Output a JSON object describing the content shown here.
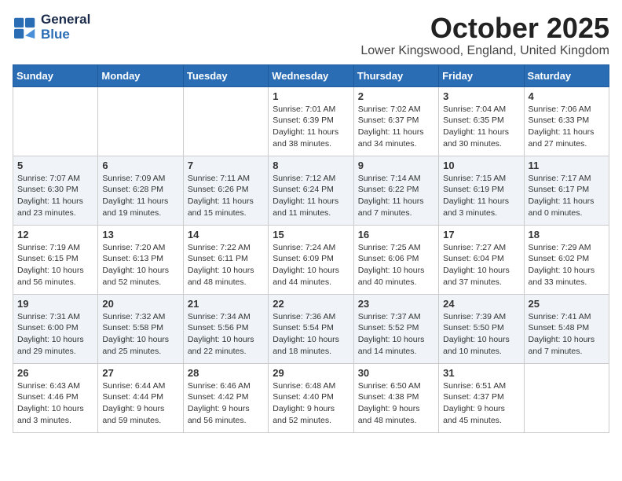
{
  "logo": {
    "line1": "General",
    "line2": "Blue"
  },
  "title": "October 2025",
  "location": "Lower Kingswood, England, United Kingdom",
  "days_of_week": [
    "Sunday",
    "Monday",
    "Tuesday",
    "Wednesday",
    "Thursday",
    "Friday",
    "Saturday"
  ],
  "weeks": [
    [
      {
        "day": "",
        "info": ""
      },
      {
        "day": "",
        "info": ""
      },
      {
        "day": "",
        "info": ""
      },
      {
        "day": "1",
        "info": "Sunrise: 7:01 AM\nSunset: 6:39 PM\nDaylight: 11 hours\nand 38 minutes."
      },
      {
        "day": "2",
        "info": "Sunrise: 7:02 AM\nSunset: 6:37 PM\nDaylight: 11 hours\nand 34 minutes."
      },
      {
        "day": "3",
        "info": "Sunrise: 7:04 AM\nSunset: 6:35 PM\nDaylight: 11 hours\nand 30 minutes."
      },
      {
        "day": "4",
        "info": "Sunrise: 7:06 AM\nSunset: 6:33 PM\nDaylight: 11 hours\nand 27 minutes."
      }
    ],
    [
      {
        "day": "5",
        "info": "Sunrise: 7:07 AM\nSunset: 6:30 PM\nDaylight: 11 hours\nand 23 minutes."
      },
      {
        "day": "6",
        "info": "Sunrise: 7:09 AM\nSunset: 6:28 PM\nDaylight: 11 hours\nand 19 minutes."
      },
      {
        "day": "7",
        "info": "Sunrise: 7:11 AM\nSunset: 6:26 PM\nDaylight: 11 hours\nand 15 minutes."
      },
      {
        "day": "8",
        "info": "Sunrise: 7:12 AM\nSunset: 6:24 PM\nDaylight: 11 hours\nand 11 minutes."
      },
      {
        "day": "9",
        "info": "Sunrise: 7:14 AM\nSunset: 6:22 PM\nDaylight: 11 hours\nand 7 minutes."
      },
      {
        "day": "10",
        "info": "Sunrise: 7:15 AM\nSunset: 6:19 PM\nDaylight: 11 hours\nand 3 minutes."
      },
      {
        "day": "11",
        "info": "Sunrise: 7:17 AM\nSunset: 6:17 PM\nDaylight: 11 hours\nand 0 minutes."
      }
    ],
    [
      {
        "day": "12",
        "info": "Sunrise: 7:19 AM\nSunset: 6:15 PM\nDaylight: 10 hours\nand 56 minutes."
      },
      {
        "day": "13",
        "info": "Sunrise: 7:20 AM\nSunset: 6:13 PM\nDaylight: 10 hours\nand 52 minutes."
      },
      {
        "day": "14",
        "info": "Sunrise: 7:22 AM\nSunset: 6:11 PM\nDaylight: 10 hours\nand 48 minutes."
      },
      {
        "day": "15",
        "info": "Sunrise: 7:24 AM\nSunset: 6:09 PM\nDaylight: 10 hours\nand 44 minutes."
      },
      {
        "day": "16",
        "info": "Sunrise: 7:25 AM\nSunset: 6:06 PM\nDaylight: 10 hours\nand 40 minutes."
      },
      {
        "day": "17",
        "info": "Sunrise: 7:27 AM\nSunset: 6:04 PM\nDaylight: 10 hours\nand 37 minutes."
      },
      {
        "day": "18",
        "info": "Sunrise: 7:29 AM\nSunset: 6:02 PM\nDaylight: 10 hours\nand 33 minutes."
      }
    ],
    [
      {
        "day": "19",
        "info": "Sunrise: 7:31 AM\nSunset: 6:00 PM\nDaylight: 10 hours\nand 29 minutes."
      },
      {
        "day": "20",
        "info": "Sunrise: 7:32 AM\nSunset: 5:58 PM\nDaylight: 10 hours\nand 25 minutes."
      },
      {
        "day": "21",
        "info": "Sunrise: 7:34 AM\nSunset: 5:56 PM\nDaylight: 10 hours\nand 22 minutes."
      },
      {
        "day": "22",
        "info": "Sunrise: 7:36 AM\nSunset: 5:54 PM\nDaylight: 10 hours\nand 18 minutes."
      },
      {
        "day": "23",
        "info": "Sunrise: 7:37 AM\nSunset: 5:52 PM\nDaylight: 10 hours\nand 14 minutes."
      },
      {
        "day": "24",
        "info": "Sunrise: 7:39 AM\nSunset: 5:50 PM\nDaylight: 10 hours\nand 10 minutes."
      },
      {
        "day": "25",
        "info": "Sunrise: 7:41 AM\nSunset: 5:48 PM\nDaylight: 10 hours\nand 7 minutes."
      }
    ],
    [
      {
        "day": "26",
        "info": "Sunrise: 6:43 AM\nSunset: 4:46 PM\nDaylight: 10 hours\nand 3 minutes."
      },
      {
        "day": "27",
        "info": "Sunrise: 6:44 AM\nSunset: 4:44 PM\nDaylight: 9 hours\nand 59 minutes."
      },
      {
        "day": "28",
        "info": "Sunrise: 6:46 AM\nSunset: 4:42 PM\nDaylight: 9 hours\nand 56 minutes."
      },
      {
        "day": "29",
        "info": "Sunrise: 6:48 AM\nSunset: 4:40 PM\nDaylight: 9 hours\nand 52 minutes."
      },
      {
        "day": "30",
        "info": "Sunrise: 6:50 AM\nSunset: 4:38 PM\nDaylight: 9 hours\nand 48 minutes."
      },
      {
        "day": "31",
        "info": "Sunrise: 6:51 AM\nSunset: 4:37 PM\nDaylight: 9 hours\nand 45 minutes."
      },
      {
        "day": "",
        "info": ""
      }
    ]
  ]
}
